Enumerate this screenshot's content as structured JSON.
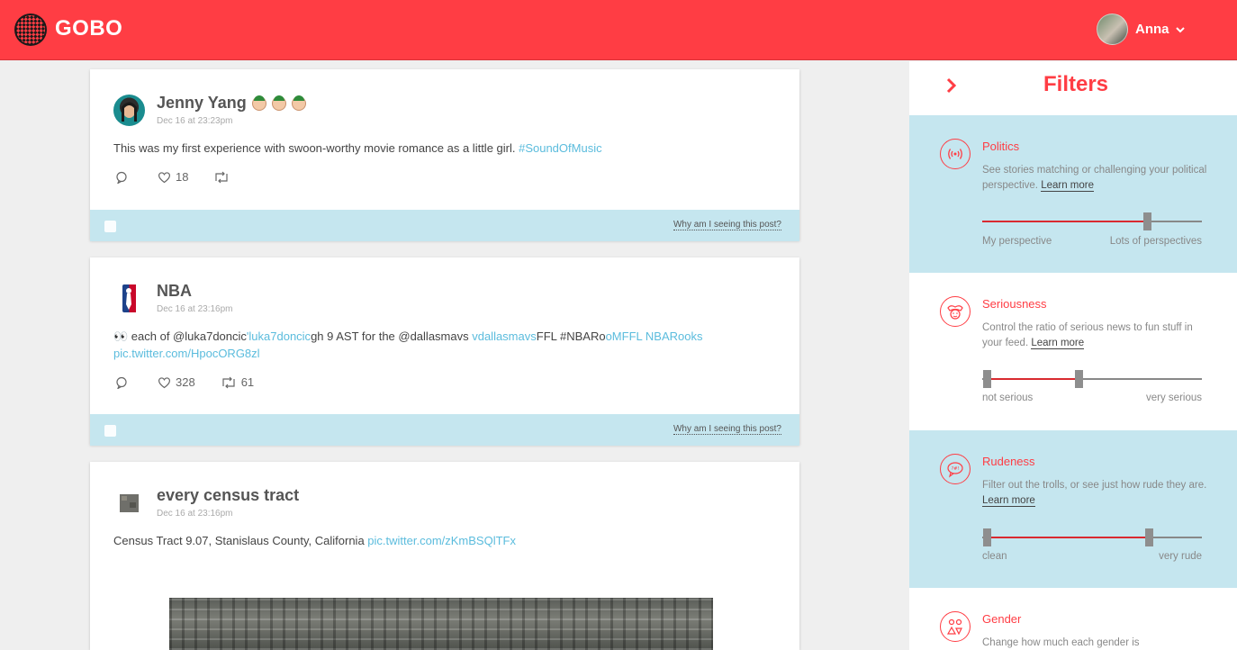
{
  "header": {
    "app_name": "GOBO",
    "user_name": "Anna"
  },
  "posts": [
    {
      "author": "Jenny Yang",
      "date": "Dec 16 at 23:23pm",
      "text": "This was my first experience with swoon-worthy movie romance as a little girl. ",
      "link": "#SoundOfMusic",
      "likes": "18",
      "retweets": "",
      "why": "Why am I seeing this post?"
    },
    {
      "author": "NBA",
      "date": "Dec 16 at 23:16pm",
      "text_prefix": "👀 each of @luka7doncic",
      "link1": "'luka7doncic",
      "text_mid": "gh 9 AST for the @dallasmavs ",
      "link2": "vdallasmavs",
      "text_mid2": "FFL #NBARo",
      "link3": "oMFFL NBARooks",
      "link4": "pic.twitter.com/HpocORG8zl",
      "likes": "328",
      "retweets": "61",
      "why": "Why am I seeing this post?"
    },
    {
      "author": "every census tract",
      "date": "Dec 16 at 23:16pm",
      "text": "Census Tract 9.07, Stanislaus County, California ",
      "link": "pic.twitter.com/zKmBSQlTFx"
    }
  ],
  "sidebar": {
    "title": "Filters",
    "filters": [
      {
        "title": "Politics",
        "desc": "See stories matching or challenging your political perspective. ",
        "learn": "Learn more",
        "min_label": "My perspective",
        "max_label": "Lots of perspectives",
        "range": [
          0,
          0.75
        ],
        "icon": "broadcast-icon"
      },
      {
        "title": "Seriousness",
        "desc": "Control the ratio of serious news to fun stuff in your feed. ",
        "learn": "Learn more",
        "min_label": "not serious",
        "max_label": "very serious",
        "range": [
          0.02,
          0.44
        ],
        "icon": "jester-icon"
      },
      {
        "title": "Rudeness",
        "desc": "Filter out the trolls, or see just how rude they are. ",
        "learn": "Learn more",
        "min_label": "clean",
        "max_label": "very rude",
        "range": [
          0.02,
          0.76
        ],
        "icon": "speech-bubble-icon"
      },
      {
        "title": "Gender",
        "desc": "Change how much each gender is",
        "icon": "gender-icon"
      }
    ]
  },
  "colors": {
    "brand_red": "#ff3d44",
    "link_blue": "#5bbcdd",
    "panel_blue": "#c5e6ef"
  }
}
